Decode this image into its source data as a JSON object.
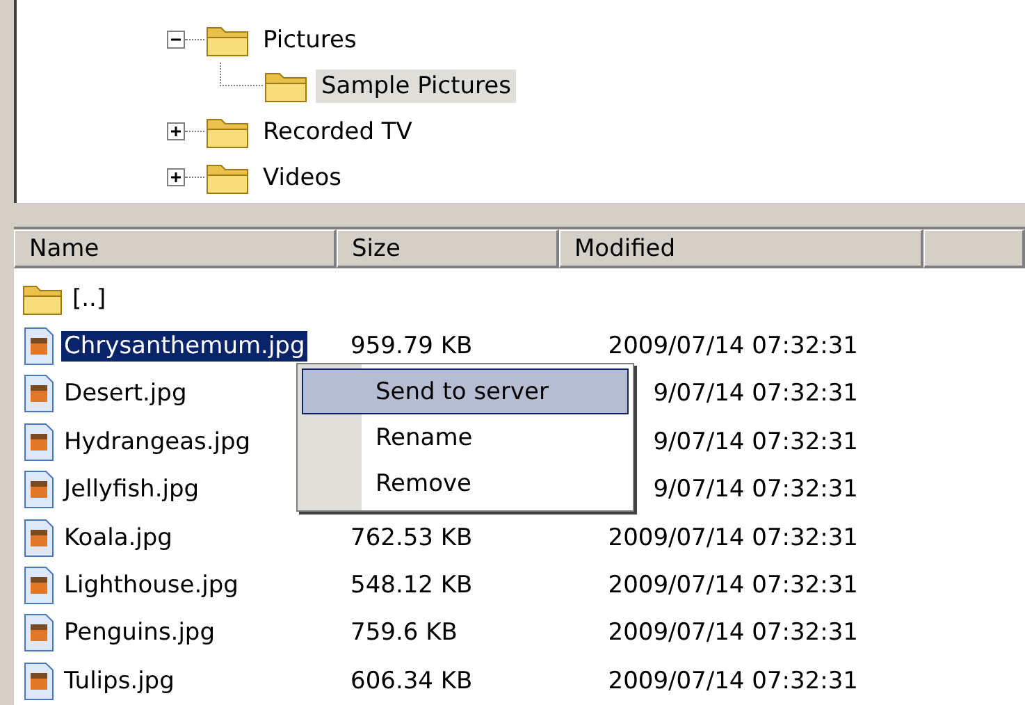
{
  "tree": [
    {
      "label": "Pictures",
      "expanded": true,
      "selected": false,
      "children": [
        {
          "label": "Sample Pictures",
          "selected": true
        }
      ]
    },
    {
      "label": "Recorded TV",
      "expanded": false,
      "selected": false
    },
    {
      "label": "Videos",
      "expanded": false,
      "selected": false
    }
  ],
  "list": {
    "columns": [
      "Name",
      "Size",
      "Modified"
    ],
    "rows": [
      {
        "kind": "folder",
        "name": "[..]",
        "size": "",
        "modified": "",
        "selected": false
      },
      {
        "kind": "file",
        "name": "Chrysanthemum.jpg",
        "size": "959.79 KB",
        "modified": "2009/07/14 07:32:31",
        "selected": true
      },
      {
        "kind": "file",
        "name": "Desert.jpg",
        "size": "",
        "modified": "9/07/14 07:32:31",
        "selected": false
      },
      {
        "kind": "file",
        "name": "Hydrangeas.jpg",
        "size": "",
        "modified": "9/07/14 07:32:31",
        "selected": false
      },
      {
        "kind": "file",
        "name": "Jellyfish.jpg",
        "size": "",
        "modified": "9/07/14 07:32:31",
        "selected": false
      },
      {
        "kind": "file",
        "name": "Koala.jpg",
        "size": "762.53 KB",
        "modified": "2009/07/14 07:32:31",
        "selected": false
      },
      {
        "kind": "file",
        "name": "Lighthouse.jpg",
        "size": "548.12 KB",
        "modified": "2009/07/14 07:32:31",
        "selected": false
      },
      {
        "kind": "file",
        "name": "Penguins.jpg",
        "size": "759.6 KB",
        "modified": "2009/07/14 07:32:31",
        "selected": false
      },
      {
        "kind": "file",
        "name": "Tulips.jpg",
        "size": "606.34 KB",
        "modified": "2009/07/14 07:32:31",
        "selected": false
      }
    ]
  },
  "context_menu": [
    {
      "label": "Send to server",
      "selected": true
    },
    {
      "label": "Rename",
      "selected": false
    },
    {
      "label": "Remove",
      "selected": false
    }
  ]
}
